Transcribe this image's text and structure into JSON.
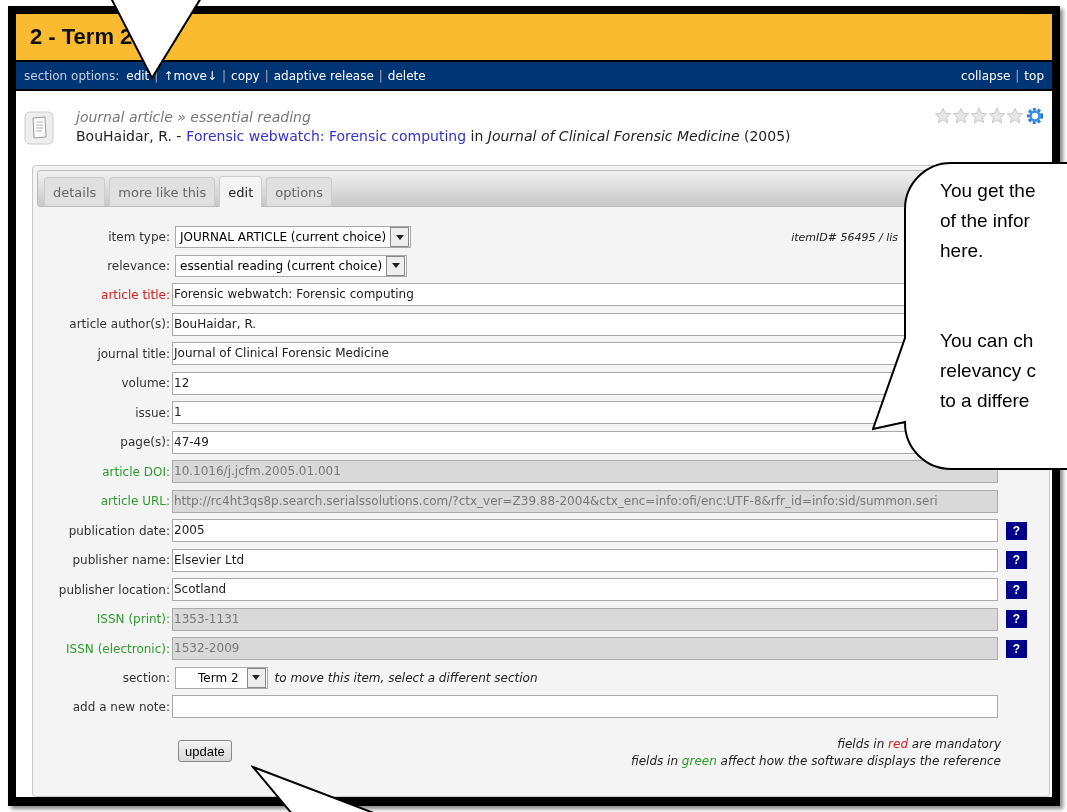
{
  "section": {
    "title": "2 - Term 2",
    "options_label": "section options:",
    "options": [
      {
        "kind": "link",
        "label": "edit"
      },
      {
        "kind": "sep",
        "label": "|"
      },
      {
        "kind": "link",
        "label": "↑move↓"
      },
      {
        "kind": "sep",
        "label": "|"
      },
      {
        "kind": "link",
        "label": "copy"
      },
      {
        "kind": "sep",
        "label": "|"
      },
      {
        "kind": "link",
        "label": "adaptive release"
      },
      {
        "kind": "sep",
        "label": "|"
      },
      {
        "kind": "link",
        "label": "delete"
      }
    ],
    "right_options": [
      {
        "kind": "link",
        "label": "collapse"
      },
      {
        "kind": "sep",
        "label": "|"
      },
      {
        "kind": "link",
        "label": "top"
      }
    ]
  },
  "item": {
    "type_line": "journal article » essential reading",
    "author": "BouHaidar, R. -",
    "title_link": "Forensic webwatch: Forensic computing",
    "rest": "in *Journal of Clinical Forensic Medicine* (2005)",
    "stars": 0
  },
  "tabs": [
    {
      "label": "details",
      "selected": false
    },
    {
      "label": "more like this",
      "selected": false
    },
    {
      "label": "edit",
      "selected": true
    },
    {
      "label": "options",
      "selected": false
    }
  ],
  "fields": [
    {
      "label": "item type:",
      "kind": "select",
      "color": "#333333",
      "value": "JOURNAL ARTICLE (current choice)",
      "meta": "itemID# 56495 / lis"
    },
    {
      "label": "relevance:",
      "kind": "select",
      "color": "#333333",
      "value": "essential reading (current choice)"
    },
    {
      "label": "article title:",
      "kind": "text",
      "color": "#d42020",
      "value": "Forensic webwatch: Forensic computing",
      "disabled": false
    },
    {
      "label": "article author(s):",
      "kind": "text",
      "color": "#333333",
      "value": "BouHaidar, R.",
      "disabled": false
    },
    {
      "label": "journal title:",
      "kind": "text",
      "color": "#333333",
      "value": "Journal of Clinical Forensic Medicine",
      "disabled": false
    },
    {
      "label": "volume:",
      "kind": "text",
      "color": "#333333",
      "value": "12",
      "disabled": false
    },
    {
      "label": "issue:",
      "kind": "text",
      "color": "#333333",
      "value": "1",
      "disabled": false
    },
    {
      "label": "page(s):",
      "kind": "text",
      "color": "#333333",
      "value": "47-49",
      "disabled": false
    },
    {
      "label": "article DOI:",
      "kind": "text",
      "color": "#2e9a2e",
      "value": "10.1016/j.jcfm.2005.01.001",
      "disabled": true
    },
    {
      "label": "article URL:",
      "kind": "text",
      "color": "#2e9a2e",
      "value": "http://rc4ht3qs8p.search.serialssolutions.com/?ctx_ver=Z39.88-2004&ctx_enc=info:ofi/enc:UTF-8&rfr_id=info:sid/summon.seri",
      "disabled": true,
      "help": false
    },
    {
      "label": "publication date:",
      "kind": "text",
      "color": "#333333",
      "value": "2005",
      "disabled": false,
      "help": true,
      "help_label": "?"
    },
    {
      "label": "publisher name:",
      "kind": "text",
      "color": "#333333",
      "value": "Elsevier Ltd",
      "disabled": false,
      "help": true,
      "help_label": "?"
    },
    {
      "label": "publisher location:",
      "kind": "text",
      "color": "#333333",
      "value": "Scotland",
      "disabled": false,
      "help": true,
      "help_label": "?"
    },
    {
      "label": "ISSN (print):",
      "kind": "text",
      "color": "#2e9a2e",
      "value": "1353-1131",
      "disabled": true,
      "help": true,
      "help_label": "?"
    },
    {
      "label": "ISSN (electronic):",
      "kind": "text",
      "color": "#2e9a2e",
      "value": "1532-2009",
      "disabled": true,
      "help": true,
      "help_label": "?"
    },
    {
      "label": "section:",
      "kind": "small_select",
      "color": "#333333",
      "value": "Term 2",
      "hint": "to move this item, select a different section"
    },
    {
      "label": "add a new note:",
      "kind": "text",
      "color": "#333333",
      "disabled": false,
      "help": false
    }
  ],
  "update_button": "update",
  "legend": [
    {
      "before": "fields in",
      "word": "red",
      "after": "are mandatory",
      "color": "#d42020"
    },
    {
      "before": "fields in",
      "word": "green",
      "after": "affect how the software displays the reference",
      "color": "#2e9a2e"
    }
  ],
  "callout": {
    "paragraphs": [
      {
        "lines": [
          "You get the",
          "of the infor",
          "here."
        ]
      },
      {
        "lines": [
          "You can ch",
          "relevancy c",
          "to a differe"
        ]
      }
    ]
  }
}
